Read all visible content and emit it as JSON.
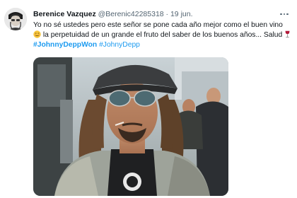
{
  "tweet": {
    "author": {
      "display_name": "Berenice Vazquez",
      "handle": "@Berenic42285318",
      "separator": "·",
      "date": "19 jun."
    },
    "text": {
      "line1": "Yo no sé ustedes pero este señor se pone cada año mejor como el buen",
      "line2_start": "vino",
      "line2_rest": "la perpetuidad de un grande el fruto del saber de los buenos",
      "line3_start": "años... Salud",
      "hashtag_1": "#JohnnyDeppWon",
      "hashtag_2": "#JohnyDepp"
    },
    "icons": {
      "emoji_1": "smiling-face-emoji",
      "emoji_2": "wine-glass-emoji",
      "more": "more-options-icon"
    },
    "colors": {
      "link": "#1d9bf0",
      "text": "#0f1419",
      "secondary": "#536471"
    }
  }
}
